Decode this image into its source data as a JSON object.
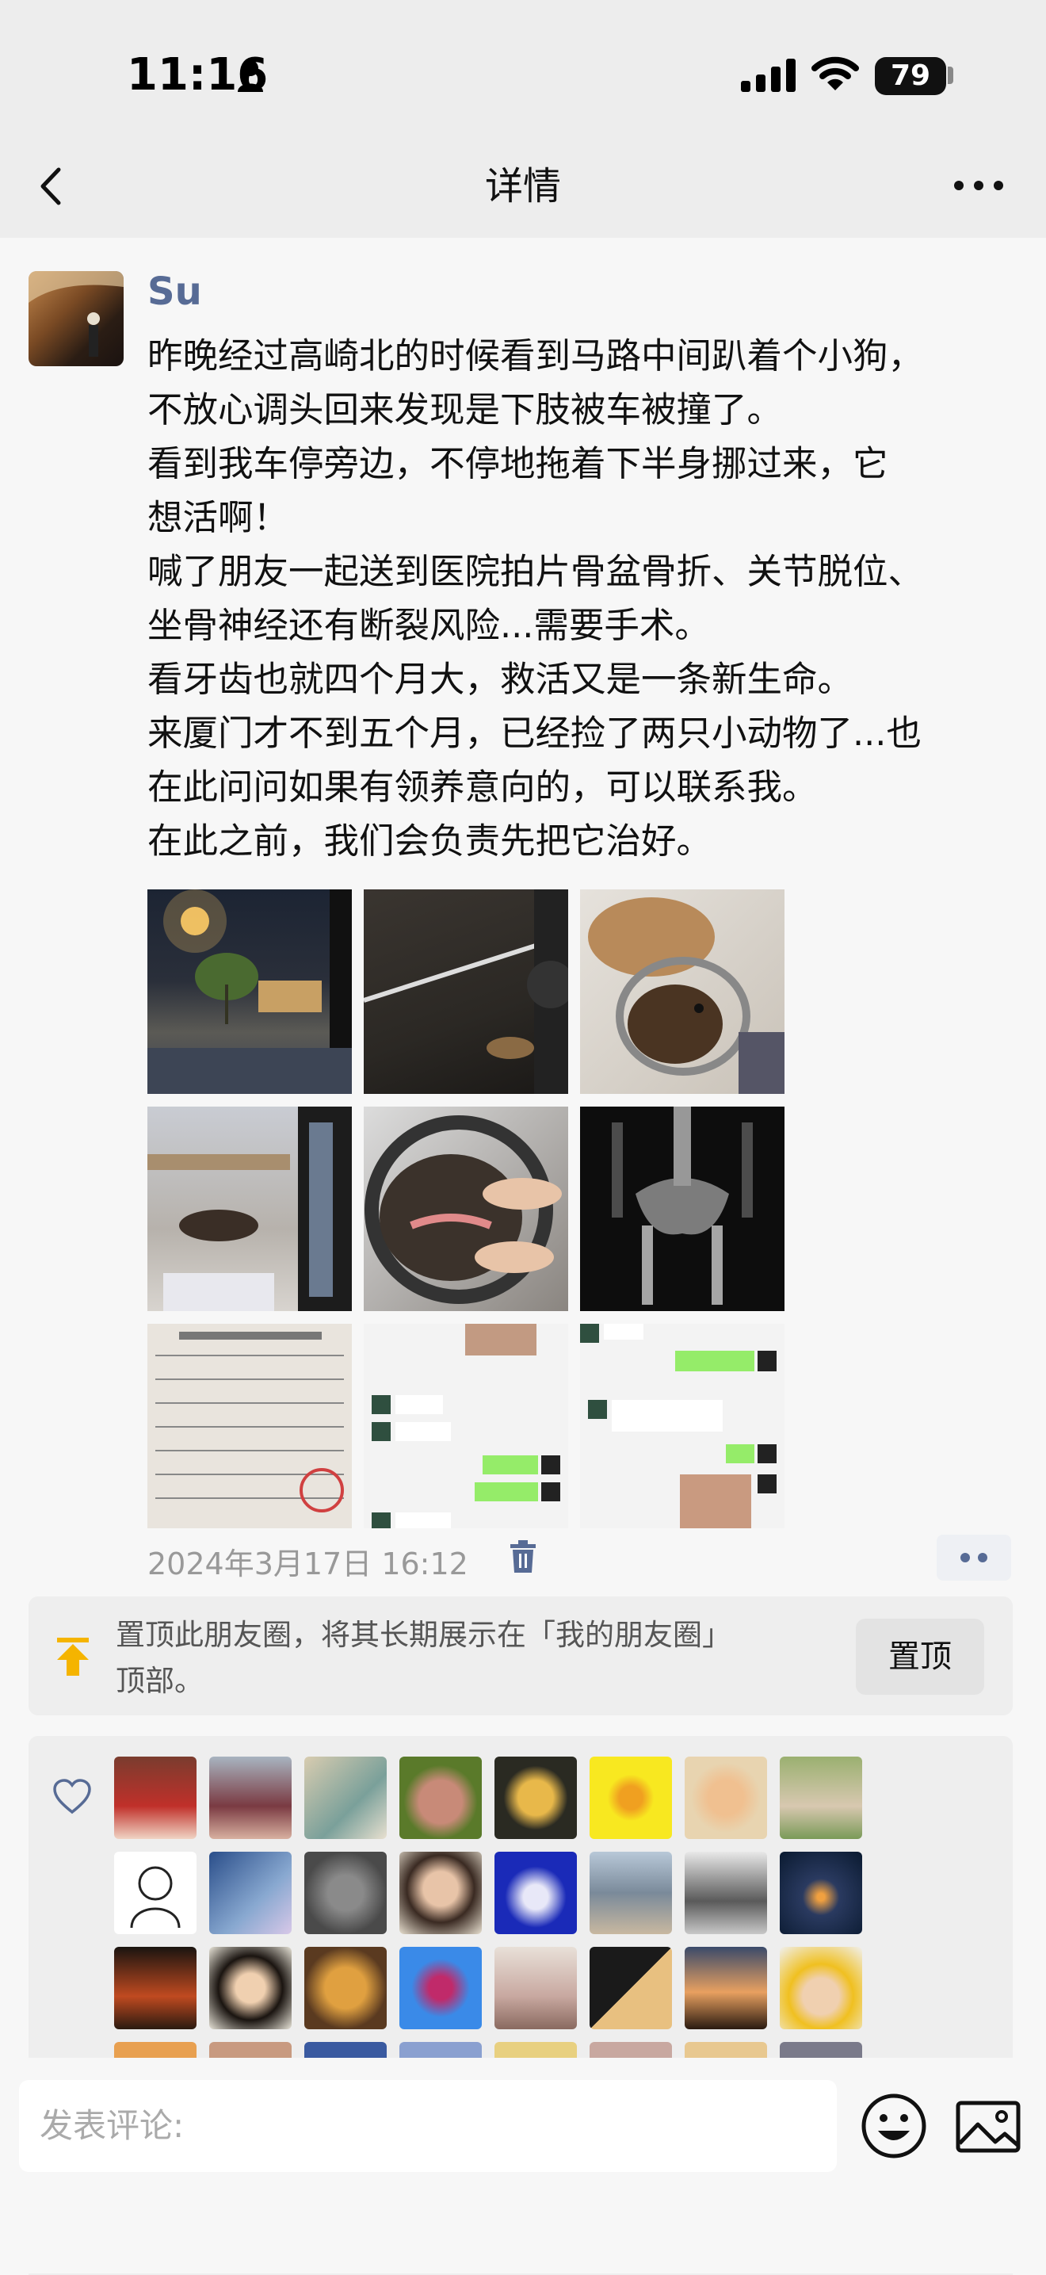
{
  "status_bar": {
    "time": "11:16",
    "battery": "79"
  },
  "nav": {
    "title": "详情"
  },
  "post": {
    "author": "Su",
    "lines": [
      "昨晚经过高崎北的时候看到马路中间趴着个小狗，",
      "不放心调头回来发现是下肢被车被撞了。",
      "看到我车停旁边，不停地拖着下半身挪过来，它",
      "想活啊！",
      "喊了朋友一起送到医院拍片骨盆骨折、关节脱位、",
      "坐骨神经还有断裂风险...需要手术。",
      "看牙齿也就四个月大，救活又是一条新生命。",
      "来厦门才不到五个月，已经捡了两只小动物了...也",
      "在此问问如果有领养意向的，可以联系我。",
      "在此之前，我们会负责先把它治好。"
    ],
    "photos": [
      "night-street-photo",
      "dog-on-road-photo",
      "dog-with-cone-photo",
      "dog-in-car-photo",
      "dog-teeth-photo",
      "xray-photo",
      "prescription-photo",
      "chat-screenshot-1",
      "chat-screenshot-2"
    ],
    "timestamp": "2024年3月17日 16:12"
  },
  "pin_card": {
    "lines": [
      "置顶此朋友圈，将其长期展示在「我的朋友圈」",
      "顶部。"
    ],
    "button": "置顶"
  },
  "comment": {
    "placeholder": "发表评论:"
  },
  "colors": {
    "name_blue": "#576b95",
    "pin_orange": "#f5b400",
    "bg_gray": "#ededed"
  }
}
